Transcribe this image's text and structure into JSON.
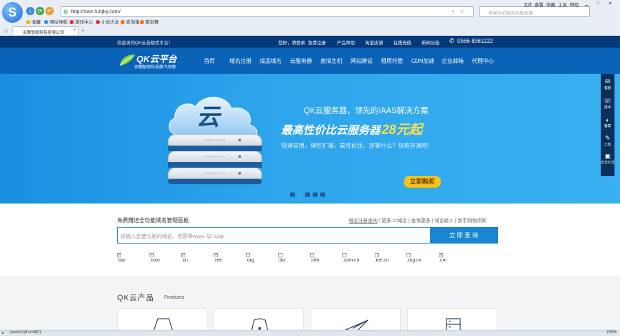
{
  "browser": {
    "url": "http://xw4.52qky.com/",
    "search_placeholder": "苹果手机电池出现故障",
    "menu": [
      "文件",
      "查看",
      "收藏",
      "工具",
      "帮助"
    ],
    "favorites": [
      "收藏",
      "网址导航",
      "游戏中心",
      "小说大全",
      "爱淘宝",
      "聚划算"
    ],
    "tab_title": "安徽智聪科技有限公司",
    "status_text": "javascript:void(0)",
    "zoom": "100%"
  },
  "topbar": {
    "welcome": "欢迎访问QK云自助式平台！",
    "links": [
      "您好，请登录",
      "免费注册",
      "产品帮助",
      "淘宝店铺",
      "在线充值",
      "新闻公告"
    ],
    "phone": "0566-8361222"
  },
  "header": {
    "logo_name": "QK云平台",
    "logo_slogan": "安徽智聪科技旗下品牌",
    "nav": [
      "首页",
      "域名注册",
      "成品域名",
      "云服务器",
      "虚拟主机",
      "网站建设",
      "租用托管",
      "CDN加速",
      "企业邮箱",
      "代理中心"
    ]
  },
  "banner": {
    "line1": "QK云服务器，领先的IAAS解决方案",
    "line2_prefix": "最高性价比云服务器",
    "line2_price": "28元起",
    "line3": "快速易用，弹性扩展，高性价比，还等什么？快来开通吧！",
    "cta": "立即购买",
    "cloud_char": "云"
  },
  "domain": {
    "title": "免费赠送全功能域名管理面板",
    "links": [
      "域名注册查询",
      "更多.cn域名",
      "查询更多",
      "域名转入",
      "新手购物须知"
    ],
    "placeholder": "请输入您要注册的域名，无需带www, 如 52qk",
    "button": "立即查询",
    "extensions": [
      {
        "name": ".top",
        "checked": true
      },
      {
        "name": ".com",
        "checked": true
      },
      {
        "name": ".cn",
        "checked": true
      },
      {
        "name": ".net",
        "checked": true
      },
      {
        "name": ".org",
        "checked": false
      },
      {
        "name": ".biz",
        "checked": false
      },
      {
        "name": ".info",
        "checked": false
      },
      {
        "name": ".com.cn",
        "checked": false
      },
      {
        "name": ".net.cn",
        "checked": false
      },
      {
        "name": ".org.cn",
        "checked": false
      },
      {
        "name": ".cm",
        "checked": true
      }
    ]
  },
  "products": {
    "title": "QK云产品",
    "subtitle": "Products"
  },
  "sidebar": [
    "客服",
    "技术",
    "备案",
    "工单",
    "支付方式"
  ],
  "colors": {
    "brand_dark": "#053a7a",
    "brand": "#0b63b8",
    "banner": "#2ea5ec",
    "price": "#ffe14a",
    "cta": "#f7c21a"
  }
}
